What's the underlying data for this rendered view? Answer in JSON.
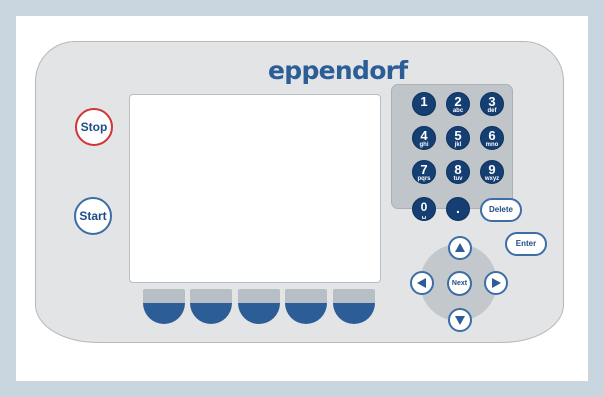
{
  "brand": {
    "name": "eppendorf"
  },
  "controls": {
    "stop_label": "Stop",
    "start_label": "Start",
    "delete_label": "Delete",
    "enter_label": "Enter",
    "next_label": "Next"
  },
  "keypad": {
    "keys": [
      {
        "digit": "1",
        "letters": ""
      },
      {
        "digit": "2",
        "letters": "abc"
      },
      {
        "digit": "3",
        "letters": "def"
      },
      {
        "digit": "4",
        "letters": "ghi"
      },
      {
        "digit": "5",
        "letters": "jkl"
      },
      {
        "digit": "6",
        "letters": "mno"
      },
      {
        "digit": "7",
        "letters": "pqrs"
      },
      {
        "digit": "8",
        "letters": "tuv"
      },
      {
        "digit": "9",
        "letters": "wxyz"
      },
      {
        "digit": "0",
        "letters": "␣"
      },
      {
        "digit": ".",
        "letters": ""
      }
    ]
  },
  "softkeys": {
    "count": 5
  },
  "colors": {
    "frame": "#c9d5df",
    "panel": "#e3e4e5",
    "accent_blue": "#2d5d96",
    "dark_blue": "#153f73",
    "stop_ring": "#cf3535",
    "brand_blue": "#2b5d97"
  },
  "icons": {
    "arrow_up": "arrow-up-icon",
    "arrow_down": "arrow-down-icon",
    "arrow_left": "arrow-left-icon",
    "arrow_right": "arrow-right-icon"
  }
}
